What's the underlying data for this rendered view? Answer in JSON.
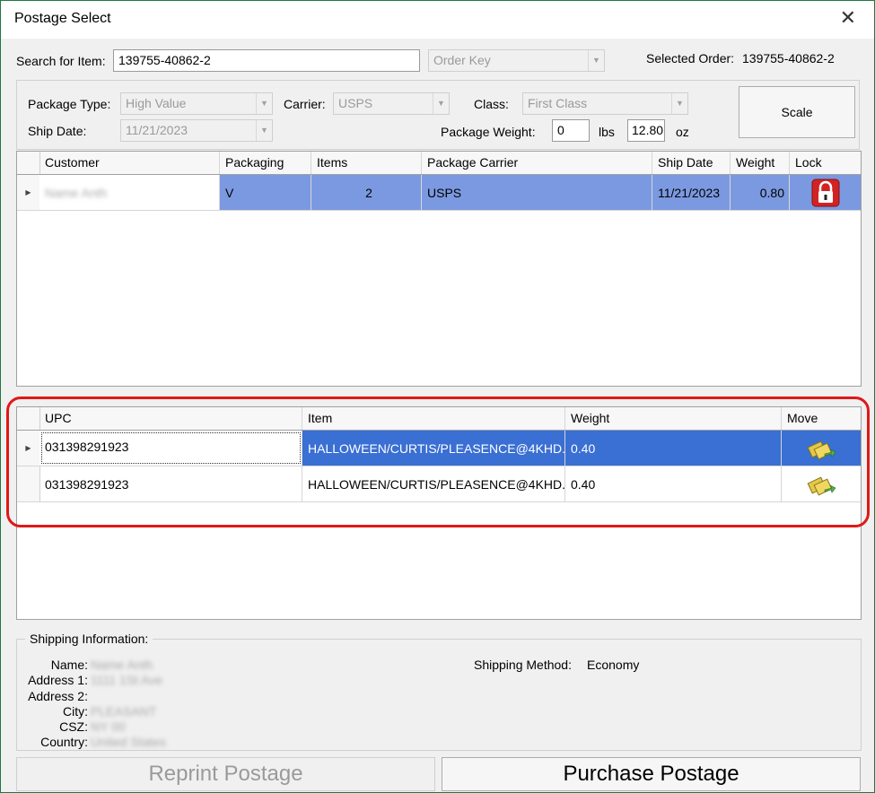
{
  "window": {
    "title": "Postage Select"
  },
  "search": {
    "label": "Search for Item:",
    "value": "139755-40862-2",
    "order_key_placeholder": "Order Key"
  },
  "selected_order": {
    "label": "Selected Order:",
    "value": "139755-40862-2"
  },
  "package": {
    "type_label": "Package Type:",
    "type_value": "High Value",
    "carrier_label": "Carrier:",
    "carrier_value": "USPS",
    "class_label": "Class:",
    "class_value": "First Class",
    "ship_date_label": "Ship Date:",
    "ship_date_value": "11/21/2023",
    "weight_label": "Package Weight:",
    "lbs_value": "0",
    "lbs_unit": "lbs",
    "oz_value": "12.80",
    "oz_unit": "oz",
    "scale_button": "Scale"
  },
  "orders_grid": {
    "columns": [
      "Customer",
      "Packaging",
      "Items",
      "Package Carrier",
      "Ship Date",
      "Weight",
      "Lock"
    ],
    "rows": [
      {
        "customer": "Name Anth",
        "packaging": "V",
        "items": "2",
        "carrier": "USPS",
        "ship_date": "11/21/2023",
        "weight": "0.80",
        "lock_icon": "lock-icon"
      }
    ]
  },
  "items_grid": {
    "columns": [
      "UPC",
      "Item",
      "Weight",
      "Move"
    ],
    "rows": [
      {
        "upc": "031398291923",
        "item": "HALLOWEEN/CURTIS/PLEASENCE@4KHD...",
        "weight": "0.40",
        "move_icon": "move-icon"
      },
      {
        "upc": "031398291923",
        "item": "HALLOWEEN/CURTIS/PLEASENCE@4KHD...",
        "weight": "0.40",
        "move_icon": "move-icon"
      }
    ]
  },
  "shipping": {
    "legend": "Shipping Information:",
    "name_label": "Name:",
    "name_value": "Name Anth",
    "address1_label": "Address 1:",
    "address1_value": "1111 1St Ave",
    "address2_label": "Address 2:",
    "address2_value": "",
    "city_label": "City:",
    "city_value": "PLEASANT",
    "csz_label": "CSZ:",
    "csz_value": "NY 00",
    "country_label": "Country:",
    "country_value": "United States",
    "method_label": "Shipping Method:",
    "method_value": "Economy"
  },
  "actions": {
    "reprint": "Reprint Postage",
    "purchase": "Purchase Postage"
  },
  "colors": {
    "selection": "#7b99e0",
    "selection_dark": "#3a6fd3",
    "annotation": "#e01818"
  }
}
